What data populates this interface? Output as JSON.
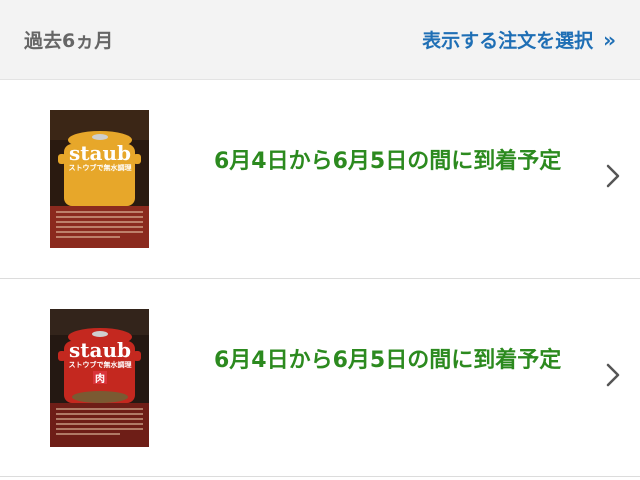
{
  "header": {
    "period_label": "過去6ヵ月",
    "select_orders_label": "表示する注文を選択",
    "select_orders_arrow": "»"
  },
  "orders": [
    {
      "delivery_text": "6月4日から6月5日の間に到着予定",
      "cover": {
        "brand": "staub",
        "subtitle": "ストウブで無水調理",
        "theme_color": "#e0a024",
        "pot_color": "#e7a72a"
      },
      "chevron_icon": "chevron-right-icon"
    },
    {
      "delivery_text": "6月4日から6月5日の間に到着予定",
      "cover": {
        "brand": "staub",
        "subtitle": "ストウブで無水調理",
        "badge": "肉",
        "theme_color": "#b8241e",
        "pot_color": "#c4281f"
      },
      "chevron_icon": "chevron-right-icon"
    }
  ],
  "colors": {
    "header_bg": "#f3f3f3",
    "link_blue": "#1f6fb5",
    "delivery_green": "#2c8a1f",
    "muted_gray": "#666666"
  }
}
